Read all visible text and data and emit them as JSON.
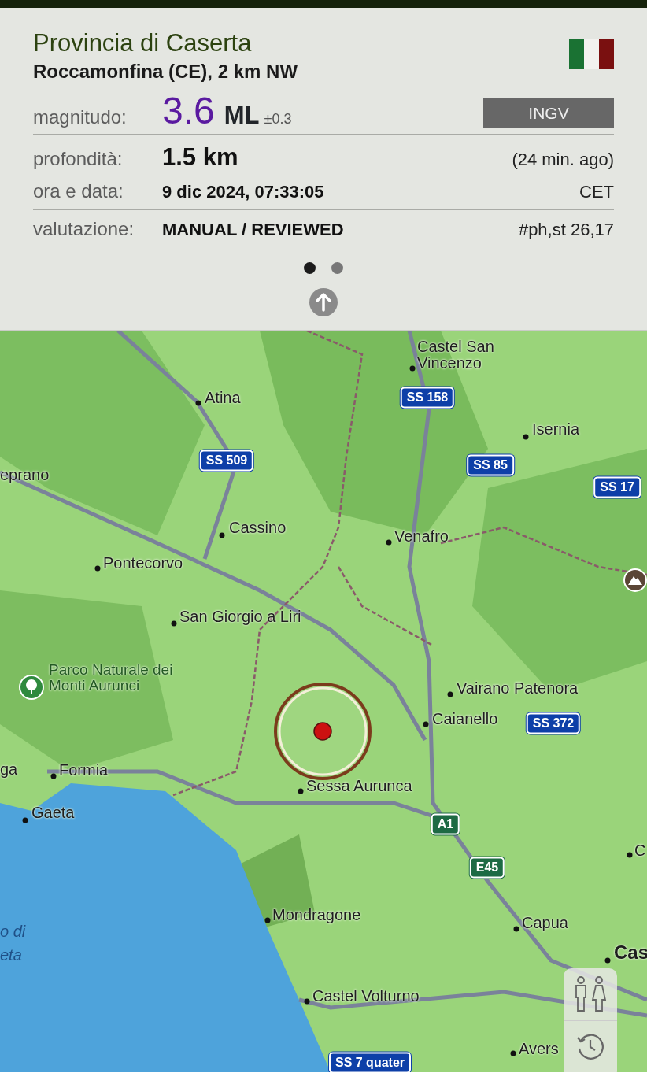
{
  "header": {
    "region": "Provincia di Caserta",
    "locality": "Roccamonfina (CE), 2 km NW"
  },
  "details": [
    {
      "kind": "magnitude",
      "label": "magnitudo:",
      "value": "3.6",
      "unit": "ML",
      "uncertainty": "±0.3",
      "aside": "INGV"
    },
    {
      "kind": "large",
      "label": "profondità:",
      "value": "1.5 km",
      "aside": "(24 min. ago)"
    },
    {
      "kind": "plain",
      "label": "ora e data:",
      "value": "9 dic 2024, 07:33:05",
      "aside": "CET"
    },
    {
      "kind": "plain",
      "label": "valutazione:",
      "value": "MANUAL / REVIEWED",
      "aside": "#ph,st 26,17"
    }
  ],
  "pager": [
    {
      "selected": true
    },
    {
      "selected": false
    }
  ],
  "map": {
    "places": [
      {
        "name": "Castel San Vincenzo",
        "kind": "town"
      },
      {
        "name": "Atina",
        "kind": "town"
      },
      {
        "name": "Isernia",
        "kind": "town"
      },
      {
        "name": "eprano",
        "kind": "town"
      },
      {
        "name": "Cassino",
        "kind": "town"
      },
      {
        "name": "Venafro",
        "kind": "town"
      },
      {
        "name": "Pontecorvo",
        "kind": "town"
      },
      {
        "name": "San Giorgio a Liri",
        "kind": "town"
      },
      {
        "name": "Parco Naturale dei Monti Aurunci",
        "kind": "park"
      },
      {
        "name": "Vairano Patenora",
        "kind": "town"
      },
      {
        "name": "Caianello",
        "kind": "town"
      },
      {
        "name": "ga",
        "kind": "town"
      },
      {
        "name": "Formia",
        "kind": "town"
      },
      {
        "name": "Sessa Aurunca",
        "kind": "town"
      },
      {
        "name": "Gaeta",
        "kind": "town"
      },
      {
        "name": "C",
        "kind": "town"
      },
      {
        "name": "o di eta",
        "kind": "sea"
      },
      {
        "name": "Mondragone",
        "kind": "town"
      },
      {
        "name": "Capua",
        "kind": "town"
      },
      {
        "name": "Cas",
        "kind": "city"
      },
      {
        "name": "Castel Volturno",
        "kind": "town"
      },
      {
        "name": "Avers",
        "kind": "town"
      }
    ],
    "shields": [
      {
        "label": "SS 158",
        "kind": "state"
      },
      {
        "label": "SS 509",
        "kind": "state"
      },
      {
        "label": "SS 85",
        "kind": "state"
      },
      {
        "label": "SS 17",
        "kind": "state"
      },
      {
        "label": "SS 372",
        "kind": "state"
      },
      {
        "label": "A1",
        "kind": "motorway"
      },
      {
        "label": "E45",
        "kind": "motorway"
      },
      {
        "label": "SS 7 quater",
        "kind": "state"
      }
    ]
  }
}
